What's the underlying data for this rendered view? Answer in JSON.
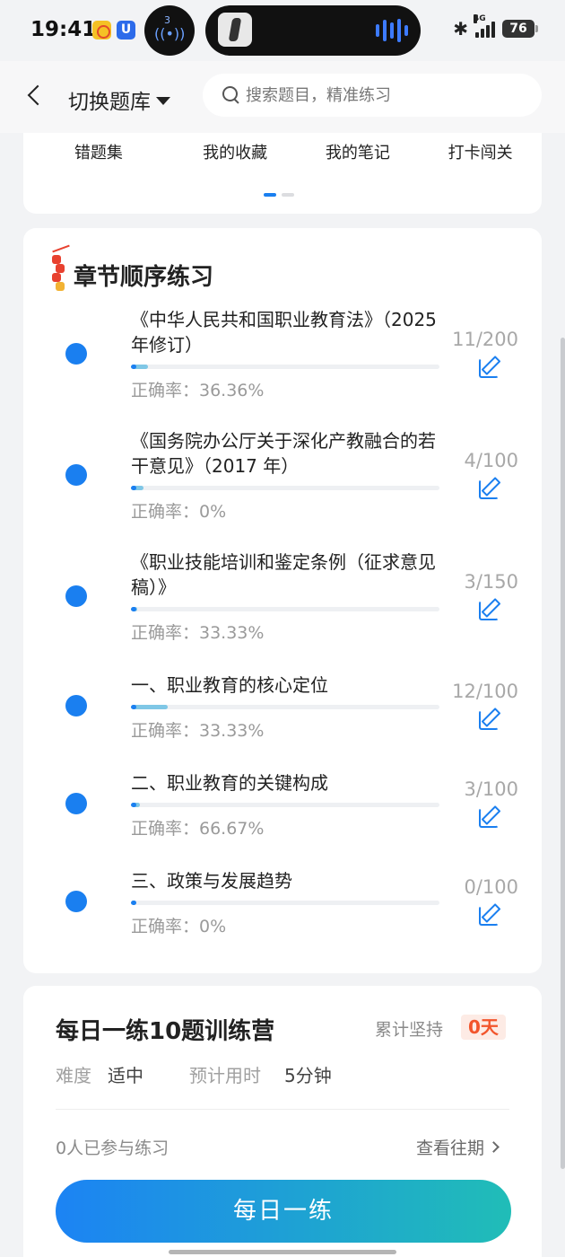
{
  "status_bar": {
    "time": "19:41",
    "app_badge": "U",
    "hotspot_count": "3",
    "network": "4G",
    "battery": "76"
  },
  "header": {
    "back_icon": "chevron-left-icon",
    "switch_bank_label": "切换题库",
    "search_placeholder": "搜索题目，精准练习"
  },
  "quick_nav": {
    "items": [
      "错题集",
      "我的收藏",
      "我的笔记",
      "打卡闯关"
    ],
    "active_page": 1,
    "total_pages": 2
  },
  "chapter_section": {
    "title": "章节顺序练习",
    "accent_color": "#1a7ff0",
    "items": [
      {
        "title": "《中华人民共和国职业教育法》（2025 年修订）",
        "progress": "11/200",
        "accuracy": "正确率：36.36%"
      },
      {
        "title": "《国务院办公厅关于深化产教融合的若干意见》（2017 年）",
        "progress": "4/100",
        "accuracy": "正确率：0%"
      },
      {
        "title": "《职业技能培训和鉴定条例（征求意见稿）》",
        "progress": "3/150",
        "accuracy": "正确率：33.33%"
      },
      {
        "title": "一、职业教育的核心定位",
        "progress": "12/100",
        "accuracy": "正确率：33.33%"
      },
      {
        "title": "二、职业教育的关键构成",
        "progress": "3/100",
        "accuracy": "正确率：66.67%"
      },
      {
        "title": "三、政策与发展趋势",
        "progress": "0/100",
        "accuracy": "正确率：0%"
      }
    ]
  },
  "daily_camp": {
    "title": "每日一练10题训练营",
    "streak_label": "累计坚持",
    "streak_value": "0天",
    "difficulty_label": "难度",
    "difficulty_value": "适中",
    "time_label": "预计用时",
    "time_value": "5分钟",
    "participants": "0人已参与练习",
    "history_link": "查看往期",
    "button_label": "每日一练",
    "button_colors": [
      "#1c83f4",
      "#20bdb7"
    ]
  }
}
